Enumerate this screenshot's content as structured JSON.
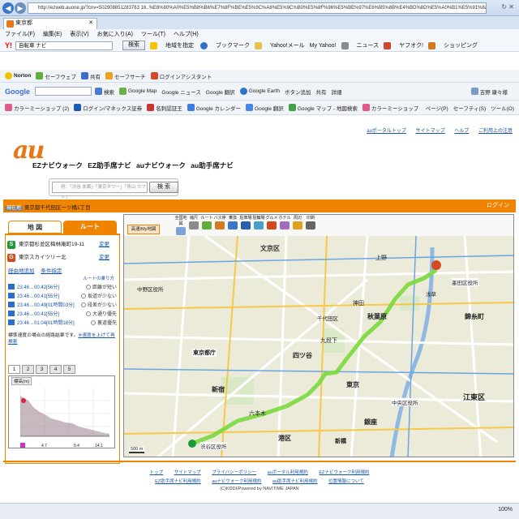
{
  "browser": {
    "url": "http://ezweb.auone.jp/?cnv=502908851283763 16..%E6%80%A0%E5%B8%B6%E7%8F%BE%E5%9C%A8%E5%9C%B0%E5%8F%96%E5%BE%97%E6%B5%8B%E4%BD%8D%E5%A0%B1%E5%91%8A%E9%A0%90&%EF%BC%88%E4%BB%BB%E6%84%8F%EF%BC%89",
    "tab_title": "東京都"
  },
  "menubar": {
    "items": [
      "ファイル(F)",
      "編集(E)",
      "表示(V)",
      "お気に入り(A)",
      "ツール(T)",
      "ヘルプ(H)"
    ]
  },
  "toolbars": {
    "yahoo": {
      "brand": "Y!",
      "search_value": "自転車 ナビ",
      "search_button": "検索",
      "items": [
        "地域を指定",
        "ブックマーク",
        "Yahoo!メール",
        "My Yahoo!",
        "ニュース",
        "ヤフオク!",
        "ショッピング"
      ]
    },
    "norton": {
      "brand": "Norton",
      "items": [
        "セーフウェブ",
        "共有",
        "セーフサーチ",
        "ログインアシスタント"
      ]
    },
    "google": {
      "brand": "Google",
      "items": [
        "検索",
        "Google Map",
        "Google ニュース",
        "Google 翻訳",
        "Google Earth",
        "ボタン追加",
        "共有",
        "詳細"
      ],
      "signin": "吉野 康々様"
    },
    "favorites": {
      "items": [
        "カラーミーショップ (2)",
        "ログイン/マネックス証券",
        "名刺認証王",
        "Google カレンダー",
        "Google 翻訳",
        "Google マップ - 地図検索",
        "カラーミーショップ"
      ],
      "right_items": [
        "ページ(P)",
        "セーフティ(S)",
        "ツール(O)"
      ]
    }
  },
  "page": {
    "top_links": [
      "auポータルトップ",
      "サイトマップ",
      "ヘルプ",
      "ご利用上の注意"
    ],
    "logo": "au",
    "products": [
      "EZナビウォーク",
      "EZ助手席ナビ",
      "auナビウォーク",
      "au助手席ナビ"
    ],
    "search": {
      "placeholder": "例：「渋谷 本郷」「東京タワー」「青山 カフェ」",
      "button": "検 索"
    },
    "login": "ログイン",
    "current": {
      "tag": "現在地",
      "text": "東京都千代田区一ツ橋1丁目"
    }
  },
  "sidebar": {
    "tab_map": "地 図",
    "tab_route": "ルート",
    "start": {
      "badge": "S",
      "text": "東京都杉並区梅林庵町19-11",
      "action": "変更"
    },
    "goal": {
      "badge": "G",
      "text": "東京スカイツリー北",
      "action": "変更"
    },
    "links": [
      "経由地追加",
      "条件指定"
    ],
    "route_note": "ルートの乗り方",
    "routes": [
      {
        "time": "23:46→00:42[56分]",
        "label": "距離が短い"
      },
      {
        "time": "23:46→00:41[55分]",
        "label": "坂道が少ない"
      },
      {
        "time": "23:46→00:49[01時間03分]",
        "label": "段差が少ない"
      },
      {
        "time": "23:46→00:41[55分]",
        "label": "大通り優先"
      },
      {
        "time": "23:46→01:04[01時間18分]",
        "label": "裏道優先"
      }
    ],
    "speed_note": "標準速度の場合の経路結果です。",
    "speed_link": "※速度を上げて再検索",
    "elev_tabs": [
      "1",
      "2",
      "3",
      "4",
      "5"
    ],
    "elev_title": "標高(m)",
    "elev_ticks": [
      "4.7",
      "9.4",
      "14.1"
    ]
  },
  "map": {
    "tools": [
      "全国地図",
      "縮尺",
      "ルート",
      "バス停",
      "乗換",
      "駐車場",
      "駐輪場",
      "グルメ",
      "ホテル",
      "周辺",
      "印刷"
    ],
    "tab": "高速/My地図",
    "labels": [
      "文京区",
      "東京都庁",
      "千代田区",
      "中野区役所",
      "新宿",
      "渋谷区役所",
      "秋葉原",
      "東京",
      "銀座",
      "浅草",
      "墨田区役所",
      "錦糸町",
      "江東区",
      "港区",
      "四ツ谷",
      "神田",
      "上野",
      "九段下",
      "六本木",
      "新橋",
      "中央区役所"
    ],
    "scale": "500 m"
  },
  "footer": {
    "links1": [
      "トップ",
      "サイトマップ",
      "プライバシーポリシー",
      "auポータル利用規約",
      "EZナビウォーク利用規約"
    ],
    "links2": [
      "EZ助手席ナビ利用規約",
      "auナビウォーク利用規約",
      "au助手席ナビ利用規約",
      "位置情報について"
    ],
    "copyright": "(C)KDDI/Powered by NAVITIME JAPAN"
  },
  "status": {
    "zoom": "100%"
  },
  "colors": {
    "orange": "#f08300",
    "green": "#1a9b3a",
    "route": "#7ad93b"
  }
}
